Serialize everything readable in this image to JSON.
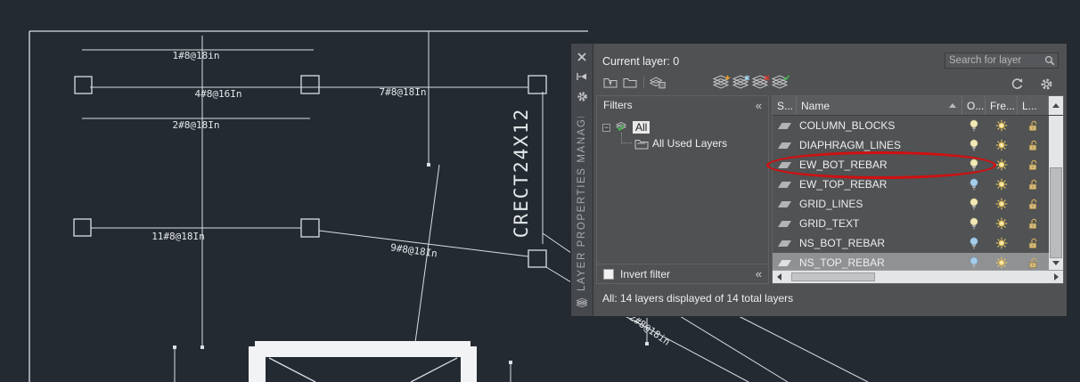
{
  "colors": {
    "drawing_bg": "#242a32",
    "line": "#dadfe3",
    "palette_bg": "#4f5153",
    "palette_strip": "#44474b",
    "header_bg": "#5a5c5e",
    "selected_row": "#8f9193",
    "highlight_red": "#d01010",
    "bulb_on": "#f2e9b6",
    "bulb_off": "#a6cde9",
    "sun": "#f3d87d",
    "lock": "#d9bd7d",
    "chip_bg": "#e9e9e9"
  },
  "drawing": {
    "labels": [
      {
        "text": "1#8@18in"
      },
      {
        "text": "4#8@16In"
      },
      {
        "text": "2#8@18In"
      },
      {
        "text": "7#8@18In"
      },
      {
        "text": "11#8@18In"
      },
      {
        "text": "9#8@18In"
      },
      {
        "text": "2#8@18in"
      },
      {
        "text": "CRECT24X12"
      }
    ]
  },
  "palette": {
    "title": "LAYER PROPERTIES MANAGER",
    "current_layer": "Current layer: 0",
    "search_placeholder": "Search for layer",
    "status_text": "All: 14 layers displayed of 14 total layers",
    "filters": {
      "header": "Filters",
      "all_label": "All",
      "all_used_label": "All Used Layers",
      "invert_label": "Invert filter",
      "collapse_glyph": "«"
    },
    "columns": {
      "status": "S...",
      "name": "Name",
      "on": "O...",
      "freeze": "Fre...",
      "lock": "L..."
    },
    "layers": [
      {
        "name": "COLUMN_BLOCKS",
        "on": true
      },
      {
        "name": "DIAPHRAGM_LINES",
        "on": true
      },
      {
        "name": "EW_BOT_REBAR",
        "on": true,
        "circled": true
      },
      {
        "name": "EW_TOP_REBAR",
        "on": false
      },
      {
        "name": "GRID_LINES",
        "on": true
      },
      {
        "name": "GRID_TEXT",
        "on": true
      },
      {
        "name": "NS_BOT_REBAR",
        "on": false
      },
      {
        "name": "NS_TOP_REBAR",
        "on": false,
        "selected": true
      }
    ],
    "icons": [
      "close",
      "pin-autohide",
      "settings-gear",
      "new-property-filter",
      "new-group-filter",
      "layer-states-manager",
      "new-layer",
      "new-frozen-layer",
      "delete-layer",
      "set-current-layer",
      "refresh",
      "search-magnifier",
      "layers-stack",
      "tree-collapse",
      "checkbox",
      "scroll-arrows"
    ]
  }
}
